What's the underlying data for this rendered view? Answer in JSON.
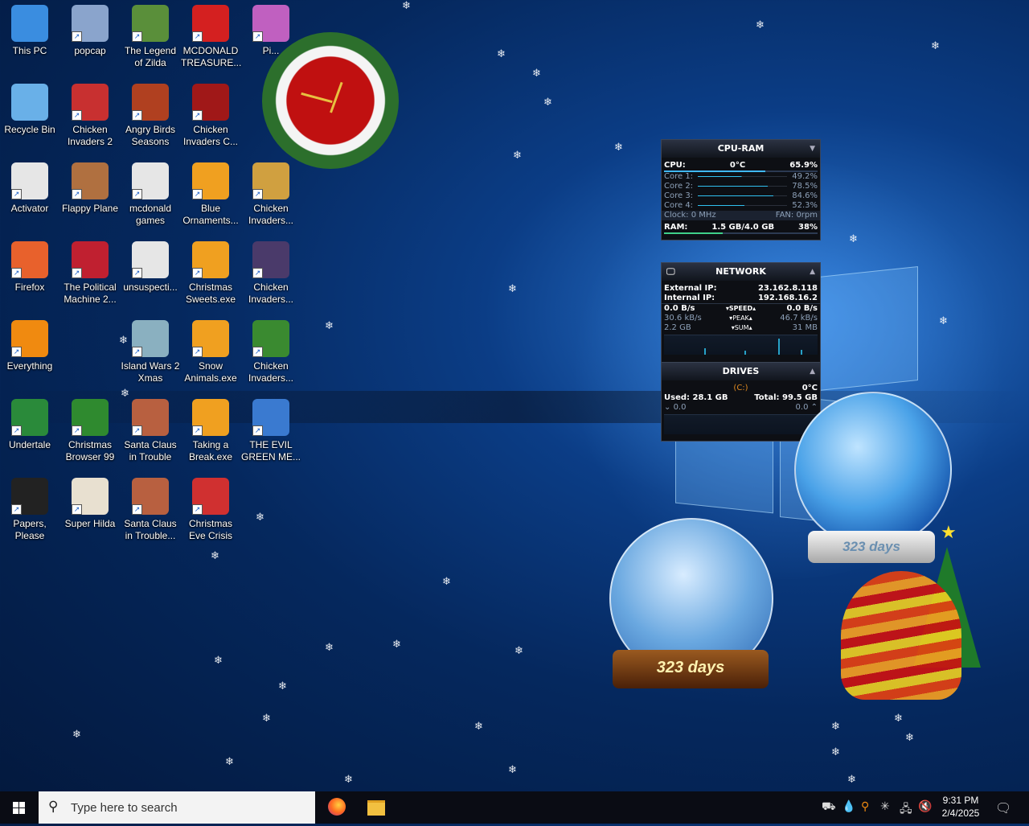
{
  "desktop": {
    "icons": [
      {
        "label": "This PC",
        "color": "#3a8de0"
      },
      {
        "label": "popcap",
        "color": "#8aa4cc"
      },
      {
        "label": "The Legend of Zilda",
        "color": "#5a8f3a"
      },
      {
        "label": "MCDONALD TREASURE...",
        "color": "#d42020"
      },
      {
        "label": "Pi...",
        "color": "#c060c0"
      },
      {
        "label": "Recycle Bin",
        "color": "#69b0e8"
      },
      {
        "label": "Chicken Invaders 2",
        "color": "#c83030"
      },
      {
        "label": "Angry Birds Seasons",
        "color": "#b04020"
      },
      {
        "label": "Chicken Invaders C...",
        "color": "#a01818"
      },
      {
        "label": "Activator",
        "color": "#e6e6e6"
      },
      {
        "label": "Flappy Plane",
        "color": "#b07040"
      },
      {
        "label": "mcdonald games",
        "color": "#e6e6e6"
      },
      {
        "label": "Blue Ornaments...",
        "color": "#f0a020"
      },
      {
        "label": "Chicken Invaders...",
        "color": "#d0a040"
      },
      {
        "label": "Firefox",
        "color": "#e8612c"
      },
      {
        "label": "The Political Machine 2...",
        "color": "#c02030"
      },
      {
        "label": "unsuspecti...",
        "color": "#e6e6e6"
      },
      {
        "label": "Christmas Sweets.exe",
        "color": "#f0a020"
      },
      {
        "label": "Chicken Invaders...",
        "color": "#4a3a6a"
      },
      {
        "label": "Everything",
        "color": "#f08a10"
      },
      {
        "label": "Island Wars 2 Xmas",
        "color": "#8ab0c0"
      },
      {
        "label": "Snow Animals.exe",
        "color": "#f0a020"
      },
      {
        "label": "Chicken Invaders...",
        "color": "#3a8a30"
      },
      {
        "label": "Undertale",
        "color": "#2a8a3a"
      },
      {
        "label": "Christmas Browser 99",
        "color": "#2f8a2f"
      },
      {
        "label": "Santa Claus in Trouble",
        "color": "#b86040"
      },
      {
        "label": "Taking a Break.exe",
        "color": "#f0a020"
      },
      {
        "label": "THE EVIL GREEN ME...",
        "color": "#3a7ad0"
      },
      {
        "label": "Papers, Please",
        "color": "#222222"
      },
      {
        "label": "Super Hilda",
        "color": "#e8e0d0"
      },
      {
        "label": "Santa Claus in Trouble...",
        "color": "#b86040"
      },
      {
        "label": "Christmas Eve Crisis",
        "color": "#d03030"
      }
    ]
  },
  "cpu_ram": {
    "title": "CPU-RAM",
    "cpu_label": "CPU:",
    "cpu_temp": "0°C",
    "cpu_pct": "65.9%",
    "cores": [
      {
        "label": "Core 1:",
        "value": "49.2%",
        "level": 0.49
      },
      {
        "label": "Core 2:",
        "value": "78.5%",
        "level": 0.785
      },
      {
        "label": "Core 3:",
        "value": "84.6%",
        "level": 0.846
      },
      {
        "label": "Core 4:",
        "value": "52.3%",
        "level": 0.523
      }
    ],
    "clock": "Clock: 0 MHz",
    "fan": "FAN: 0rpm",
    "ram_label": "RAM:",
    "ram_value": "1.5 GB/4.0 GB",
    "ram_pct": "38%"
  },
  "network": {
    "title": "NETWORK",
    "external_label": "External IP:",
    "external_ip": "23.162.8.118",
    "internal_label": "Internal IP:",
    "internal_ip": "192.168.16.2",
    "speed_down": "0.0 B/s",
    "speed_label": "SPEED",
    "speed_up": "0.0 B/s",
    "peak_down": "30.6 kB/s",
    "peak_label": "PEAK",
    "peak_up": "46.7 kB/s",
    "sum_down": "2.2 GB",
    "sum_label": "SUM",
    "sum_up": "31 MB"
  },
  "drives": {
    "title": "DRIVES",
    "drive": "(C:)",
    "temp": "0°C",
    "used": "Used: 28.1 GB",
    "total": "Total: 99.5 GB",
    "read": "0.0",
    "write": "0.0"
  },
  "globes": {
    "countdown_1": "323 days",
    "countdown_2": "323 days"
  },
  "taskbar": {
    "search_placeholder": "Type here to search",
    "time": "9:31 PM",
    "date": "2/4/2025"
  }
}
